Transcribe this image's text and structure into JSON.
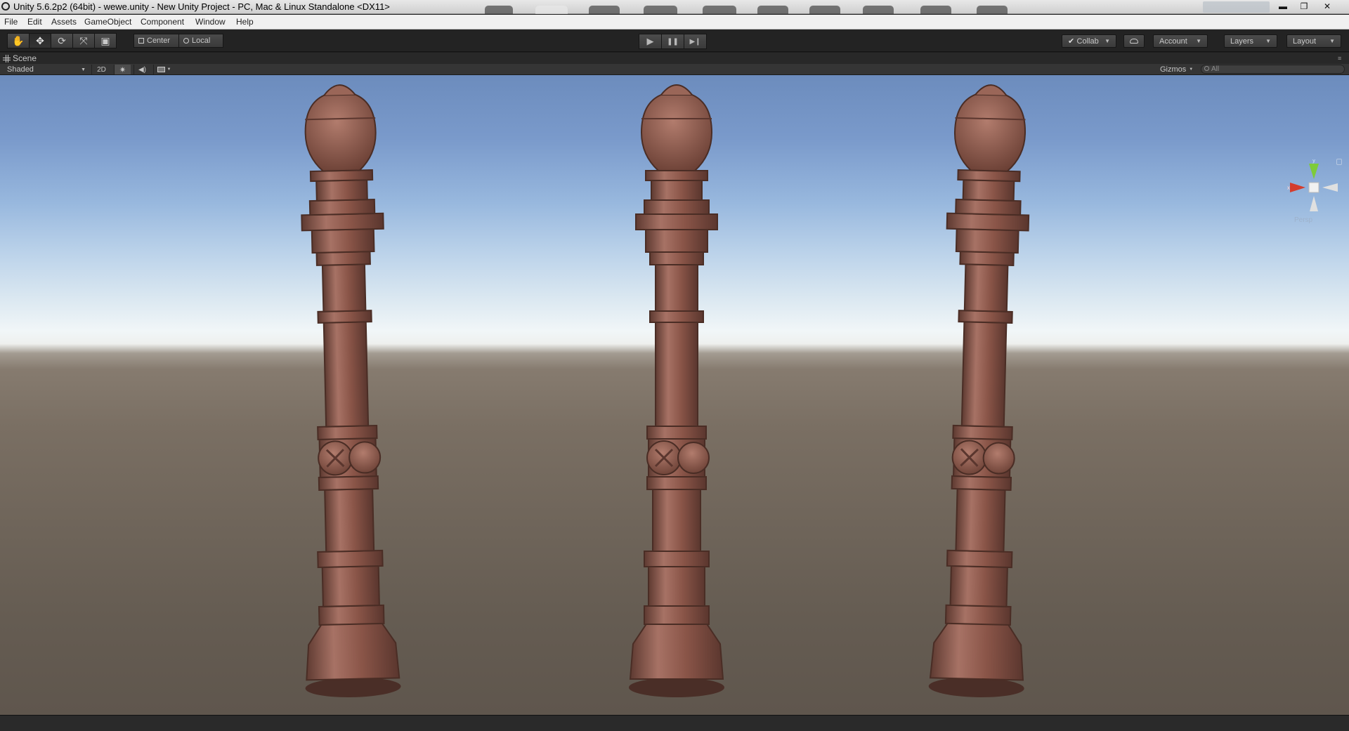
{
  "window": {
    "title": "Unity 5.6.2p2 (64bit) - wewe.unity - New Unity Project - PC, Mac & Linux Standalone <DX11>",
    "controls": {
      "minimize": "▬",
      "restore": "❐",
      "close": "✕"
    }
  },
  "menu": [
    "File",
    "Edit",
    "Assets",
    "GameObject",
    "Component",
    "Window",
    "Help"
  ],
  "toolbar": {
    "transform_tools": [
      {
        "name": "hand-tool",
        "icon": "hand-icon",
        "glyph": "✋",
        "active": false
      },
      {
        "name": "move-tool",
        "icon": "move-icon",
        "glyph": "✥",
        "active": true
      },
      {
        "name": "rotate-tool",
        "icon": "rotate-icon",
        "glyph": "⟳",
        "active": false
      },
      {
        "name": "scale-tool",
        "icon": "scale-icon",
        "glyph": "⤧",
        "active": false
      },
      {
        "name": "rect-tool",
        "icon": "rect-icon",
        "glyph": "▣",
        "active": false
      }
    ],
    "pivot_mode": "Center",
    "pivot_space": "Local",
    "playback": {
      "play": "▶",
      "pause": "❚❚",
      "step": "▶❙"
    },
    "collab": "Collab",
    "account": "Account",
    "layers": "Layers",
    "layout": "Layout"
  },
  "scene": {
    "tab_label": "Scene",
    "shading_mode": "Shaded",
    "mode_2d": "2D",
    "lighting_icon": "sun-icon",
    "audio_icon": "speaker-icon",
    "effects_icon": "image-icon",
    "gizmos": "Gizmos",
    "search_placeholder": "All",
    "view_gizmo": {
      "x": "x",
      "y": "y",
      "z": "z",
      "projection": "Persp"
    }
  },
  "colors": {
    "post": "#8a5548",
    "post_light": "#a77265",
    "post_dark": "#5e3a31",
    "gizmo_x": "#d43c2c",
    "gizmo_y": "#7ecb3a",
    "gizmo_z": "#3a78d4"
  }
}
